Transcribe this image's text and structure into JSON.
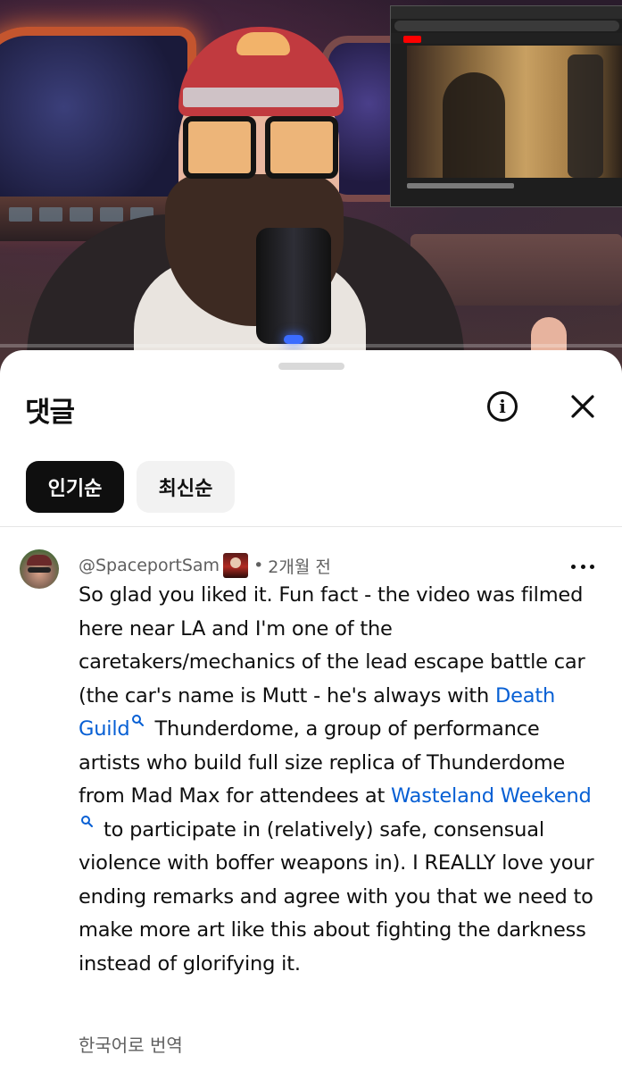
{
  "sheet": {
    "title": "댓글",
    "sort_chips": [
      {
        "label": "인기순",
        "selected": true
      },
      {
        "label": "최신순",
        "selected": false
      }
    ]
  },
  "comment": {
    "author": "@SpaceportSam",
    "separator": "•",
    "time": "2개월 전",
    "text_parts": [
      "So glad you liked it. Fun fact - the video was filmed here near LA and I'm one of the caretakers/mechanics of the lead escape battle car (the car's name is Mutt - he's always with ",
      "Death Guild",
      "Thunderdome, a group of performance artists who build full size replica of Thunderdome from Mad Max for attendees at ",
      "Wasteland Weekend",
      "to participate in (relatively) safe, consensual violence with boffer weapons in). I REALLY love your ending remarks and agree with you that we need to make more art like this about fighting the darkness instead of glorifying it."
    ],
    "translate_label": "한국어로 번역"
  },
  "colors": {
    "link": "#065fd4",
    "chip_active_bg": "#0f0f0f",
    "chip_inactive_bg": "#f2f2f2",
    "secondary_text": "#606060"
  },
  "icons": {
    "info": "info-icon",
    "close": "close-icon",
    "more": "more-vert-icon",
    "search": "search-icon"
  }
}
